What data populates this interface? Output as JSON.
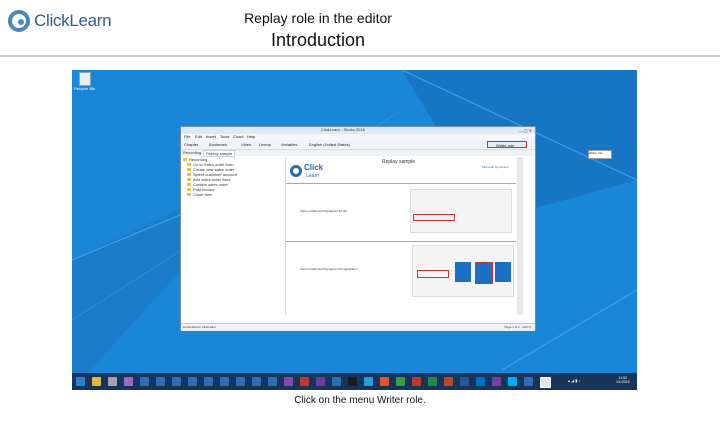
{
  "header": {
    "logo_text": "ClickLearn",
    "title": "Replay role in the editor",
    "subtitle": "Introduction"
  },
  "caption": "Click on the menu Writer role.",
  "colors": {
    "desktop_bg": "#1a86d8",
    "taskbar": "#15355a",
    "highlight": "#d0312d",
    "brand": "#2b6ca8"
  },
  "desktop": {
    "recycle_bin_label": "Recycle Bin"
  },
  "app": {
    "title": "ClickLearn - Studio 2016",
    "menu": [
      "File",
      "Edit",
      "Insert",
      "Tools",
      "Cloud",
      "Help"
    ],
    "toolbar": [
      "Chapter",
      "Bookmark",
      "Video",
      "Lineup",
      "Variables",
      "English (United States)"
    ],
    "writer_role_label": "Writer role",
    "tooltip": "Writer role",
    "tab_label": "Recording",
    "active_tab": "Replay sample",
    "tree_items": [
      "Recording",
      "Go to Sales order form",
      "Create new sales order",
      "Select customer account",
      "Add sales order lines",
      "Confirm sales order",
      "Post invoice",
      "Close form"
    ],
    "content": {
      "brand_text": "Click",
      "brand_sub": "Learn",
      "page_title": "Replay sample",
      "ms_dynamics": "Microsoft Dynamics",
      "step1": "Click on Microsoft Dynamics AX tile",
      "step2": "Click on Microsoft Dynamics AX application"
    },
    "status_left": "Connected to ClickLearn",
    "status_right": "Page 1 of 1 - 100 %"
  }
}
